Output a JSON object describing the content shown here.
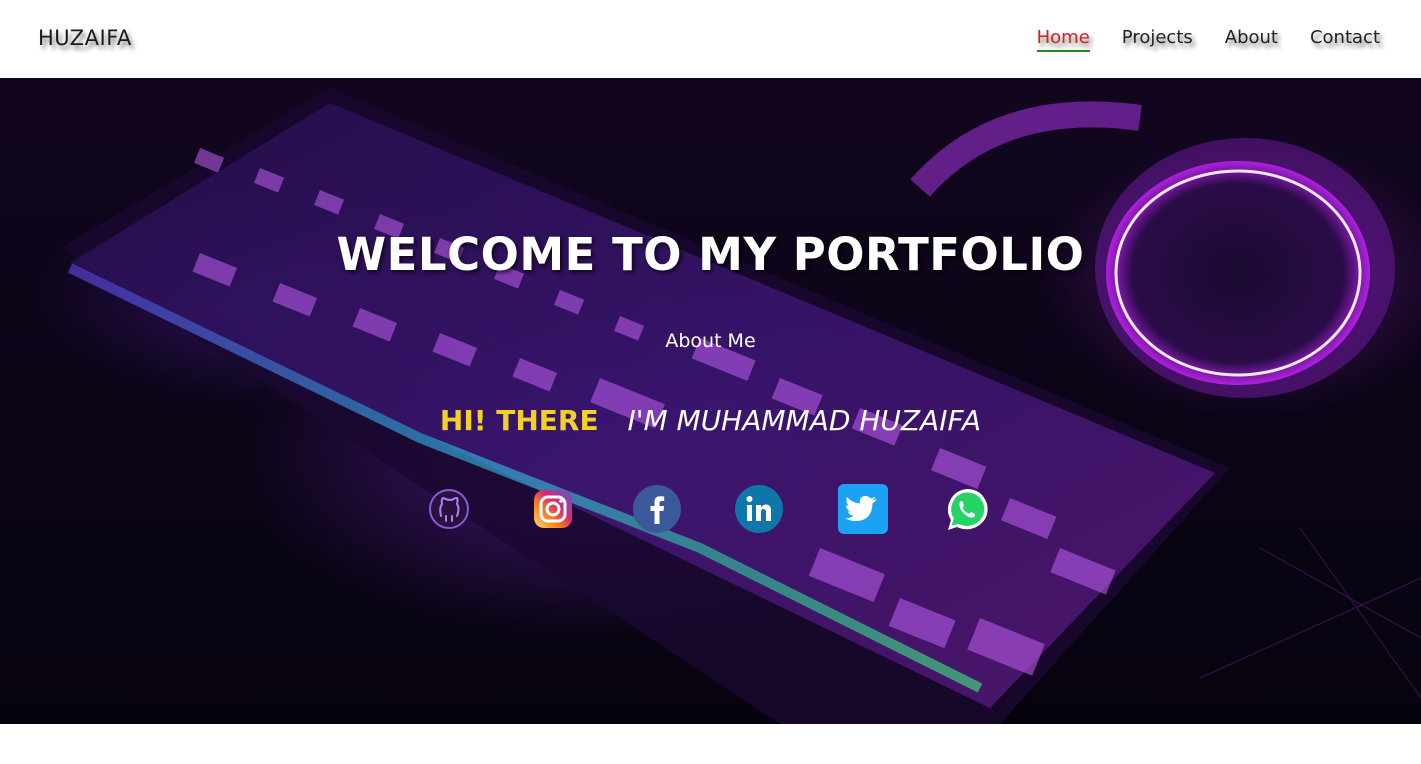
{
  "navbar": {
    "brand": "HUZAIFA",
    "links": [
      {
        "label": "Home",
        "active": true
      },
      {
        "label": "Projects",
        "active": false
      },
      {
        "label": "About",
        "active": false
      },
      {
        "label": "Contact",
        "active": false
      }
    ],
    "active_color": "#d42020",
    "underline_color": "#1f8a2c"
  },
  "hero": {
    "title": "WELCOME TO MY PORTFOLIO",
    "about_link": "About Me",
    "greeting": "HI! THERE",
    "name": "I'M MUHAMMAD HUZAIFA",
    "greeting_color": "#f2d024",
    "socials": [
      {
        "icon": "github-icon"
      },
      {
        "icon": "instagram-icon"
      },
      {
        "icon": "facebook-icon"
      },
      {
        "icon": "linkedin-icon"
      },
      {
        "icon": "twitter-icon"
      },
      {
        "icon": "whatsapp-icon"
      }
    ]
  }
}
